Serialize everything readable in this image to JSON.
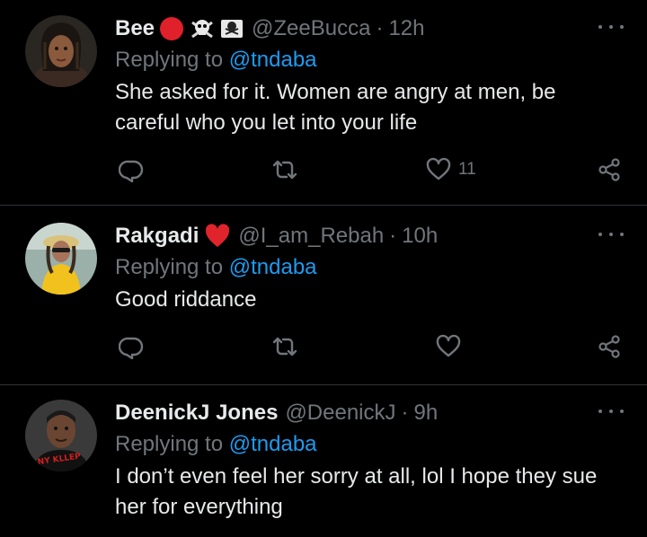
{
  "replies": [
    {
      "name": "Bee",
      "badges": [
        "red-circle-emoji",
        "skull-crossbones-emoji",
        "skull-crossbones-square-emoji"
      ],
      "handle": "@ZeeBucca",
      "separator": "·",
      "time": "12h",
      "replying_prefix": "Replying to ",
      "replying_to": "@tndaba",
      "text": "She asked for it. Women are angry at men, be careful who you let into your life",
      "like_count": "11"
    },
    {
      "name": "Rakgadi",
      "badges": [
        "red-heart-emoji"
      ],
      "handle": "@I_am_Rebah",
      "separator": "·",
      "time": "10h",
      "replying_prefix": "Replying to ",
      "replying_to": "@tndaba",
      "text": "Good riddance",
      "like_count": ""
    },
    {
      "name": "DeenickJ Jones",
      "badges": [],
      "handle": "@DeenickJ",
      "separator": "·",
      "time": "9h",
      "replying_prefix": "Replying to ",
      "replying_to": "@tndaba",
      "text": "I don’t even feel her sorry at all, lol I hope they sue her for everything",
      "like_count": ""
    }
  ],
  "colors": {
    "background": "#000000",
    "primary_text": "#e7e9ea",
    "secondary_text": "#71767b",
    "mention": "#1d9bf0",
    "divider": "#2f3336"
  },
  "icons": [
    "reply-icon",
    "retweet-icon",
    "like-icon",
    "share-icon",
    "more-icon"
  ]
}
